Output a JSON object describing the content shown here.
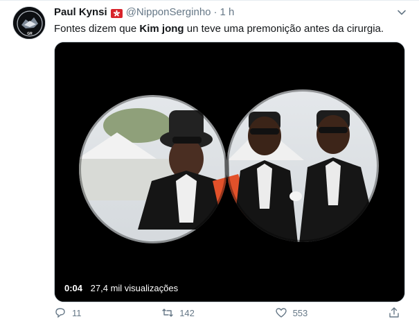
{
  "tweet": {
    "display_name": "Paul Kynsi",
    "handle": "@NipponSerginho",
    "separator": "·",
    "time": "1 h",
    "text_before": "Fontes dizem que ",
    "text_bold": "Kim jong",
    "text_after": " un teve uma premonição antes da cirurgia.",
    "avatar_text": "CRYPTOMAX GR"
  },
  "video": {
    "duration": "0:04",
    "views": "27,4 mil visualizações"
  },
  "actions": {
    "reply_count": "11",
    "retweet_count": "142",
    "like_count": "553"
  },
  "colors": {
    "flag_red": "#d8232a",
    "link_gray": "#657786",
    "video_bg": "#000000"
  }
}
